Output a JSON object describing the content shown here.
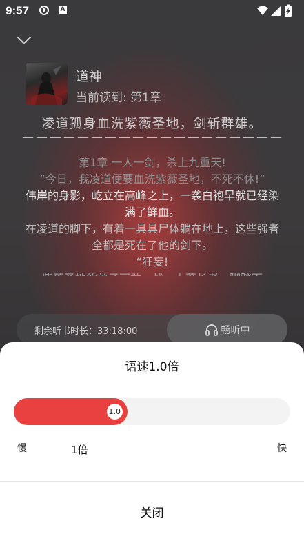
{
  "status_bar": {
    "time": "9:57",
    "icon_b_letter": "A"
  },
  "book": {
    "title": "道神",
    "progress": "当前读到: 第1章",
    "summary": "凌道孤身血洗紫薇圣地，剑斩群雄。",
    "divider": "———————————————————————"
  },
  "reader_lines": [
    "第1章 一人一剑，杀上九重天!",
    "“今日，我凌道便要血洗紫薇圣地，不死不休!”",
    "伟岸的身影，屹立在高峰之上，一袭白袍早就已经染满了鲜血。",
    "在凌道的脚下，有着一具具尸体躺在地上，这些强者全都是死在了他的剑下。",
    "“狂妄!",
    "紫薇圣地的弟子可敢一战，大薇长老一脚踏下"
  ],
  "listen_bar": {
    "remaining_label": "剩余听书时长：33:18:00",
    "button_label": "畅听中",
    "button_icon": "headphones-icon"
  },
  "speed_sheet": {
    "title": "语速1.0倍",
    "slider_value": 1.0,
    "slider_min": 0.5,
    "slider_max": 3.0,
    "thumb_label": "1.0",
    "slow_label": "慢",
    "fast_label": "快",
    "current_label": "1倍",
    "close_label": "关闭",
    "accent_color": "#e8413f"
  }
}
